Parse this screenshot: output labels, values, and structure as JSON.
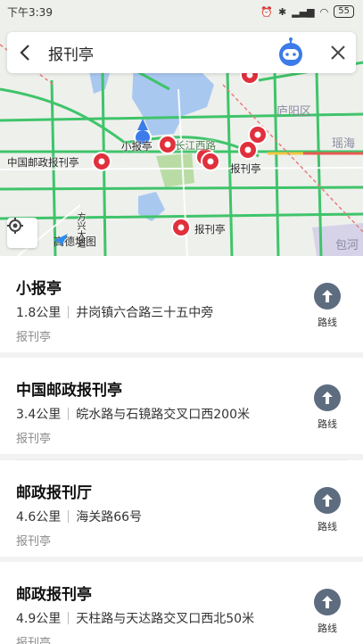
{
  "status_bar": {
    "time": "下午3:39",
    "battery": "55"
  },
  "search": {
    "query": "报刊亭"
  },
  "map": {
    "labels": {
      "poi_1": "小报亭",
      "poi_2": "中国邮政报刊亭",
      "poi_3": "报刊亭",
      "poi_4": "报刊亭",
      "district": "庐阳区",
      "road": "长江西路",
      "area": "瑶海",
      "area2": "包河",
      "fangxing": "方兴大道"
    },
    "logo": "高德地图"
  },
  "results": [
    {
      "name": "小报亭",
      "distance": "1.8公里",
      "address": "井岗镇六合路三十五中旁",
      "category": "报刊亭",
      "route_label": "路线"
    },
    {
      "name": "中国邮政报刊亭",
      "distance": "3.4公里",
      "address": "皖水路与石镜路交叉口西200米",
      "category": "报刊亭",
      "route_label": "路线"
    },
    {
      "name": "邮政报刊厅",
      "distance": "4.6公里",
      "address": "海关路66号",
      "category": "报刊亭",
      "route_label": "路线"
    },
    {
      "name": "邮政报刊亭",
      "distance": "4.9公里",
      "address": "天柱路与天达路交叉口西北50米",
      "category": "报刊亭",
      "route_label": "路线"
    }
  ],
  "colors": {
    "accent": "#5e6c80",
    "pin": "#e0303c",
    "road_green": "#3fc46a",
    "water": "#a9c8ef"
  }
}
